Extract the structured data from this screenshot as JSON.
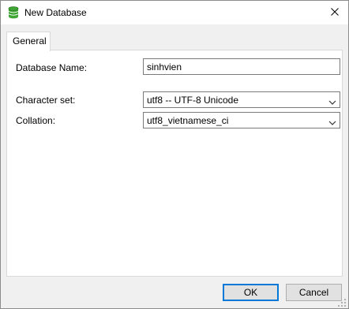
{
  "window": {
    "title": "New Database",
    "icon": "database-icon",
    "close_icon": "close-icon"
  },
  "tabs": [
    {
      "label": "General",
      "selected": true
    }
  ],
  "form": {
    "database_name_label": "Database Name:",
    "database_name_value": "sinhvien",
    "character_set_label": "Character set:",
    "character_set_value": "utf8 -- UTF-8 Unicode",
    "collation_label": "Collation:",
    "collation_value": "utf8_vietnamese_ci"
  },
  "buttons": {
    "ok_label": "OK",
    "cancel_label": "Cancel"
  },
  "colors": {
    "accent": "#0078d7",
    "icon_green": "#3fa535"
  }
}
